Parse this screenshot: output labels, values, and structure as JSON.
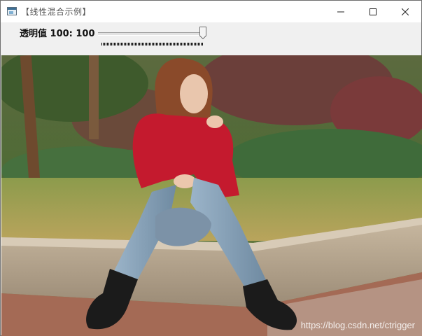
{
  "window": {
    "title": "【线性混合示例】"
  },
  "controls": {
    "minimize_icon": "minimize-icon",
    "maximize_icon": "maximize-icon",
    "close_icon": "close-icon"
  },
  "trackbar": {
    "label": "透明值 100: 100",
    "value": 100,
    "max": 100
  },
  "image": {
    "watermark": "https://blog.csdn.net/ctrigger"
  }
}
